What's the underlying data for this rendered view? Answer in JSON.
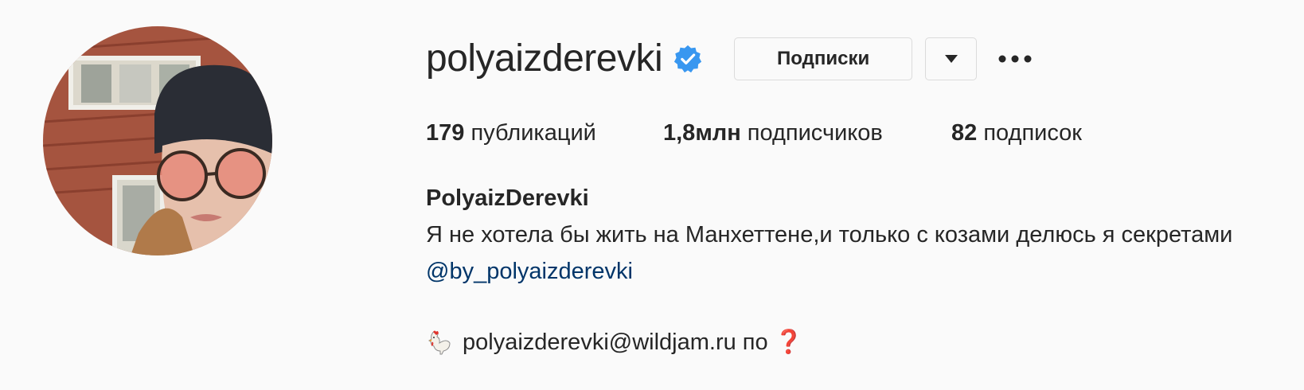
{
  "profile": {
    "username": "polyaizderevki",
    "verified_icon": "verified-badge-icon",
    "follow_button_label": "Подписки",
    "dropdown_icon": "triangle-down-icon",
    "more_icon": "more-horizontal-icon"
  },
  "stats": {
    "posts_count": "179",
    "posts_label": " публикаций",
    "followers_count": "1,8млн",
    "followers_label": " подписчиков",
    "following_count": "82",
    "following_label": " подписок"
  },
  "bio": {
    "full_name": "PolyaizDerevki",
    "text": "Я не хотела бы жить на Манхеттене,и только с козами делюсь я секретами",
    "link": "@by_polyaizderevki",
    "contact_emoji": "rooster-icon",
    "contact_text": "polyaizderevki@wildjam.ru по",
    "contact_end_emoji": "question-mark-icon",
    "contact_end_glyph": "❓"
  },
  "colors": {
    "background": "#fafafa",
    "text": "#262626",
    "link": "#003569",
    "border": "#dbdbdb",
    "verified": "#3897f0"
  }
}
